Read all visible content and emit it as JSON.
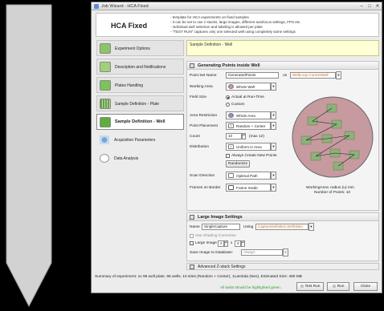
{
  "window": {
    "title": "Job Wizard - HCA Fixed",
    "minimize_glyph": "–",
    "maximize_glyph": "□",
    "close_glyph": "✕"
  },
  "header": {
    "title": "HCA Fixed",
    "description": [
      "template for HCA experiments on fixed samples",
      "it can be set to use z-stacks, large images, different autofocus settings, FPS etc.",
      "individual well selection and labeling is allowed per plate",
      "\"TEST RUN\" captures only one selected well using completely same settings"
    ]
  },
  "sidebar": {
    "items": [
      {
        "label": "Experiment Options",
        "icon": "experiment-options-icon"
      },
      {
        "label": "Description and Notifications",
        "icon": "description-icon"
      },
      {
        "label": "Plates Handling",
        "icon": "plates-handling-icon"
      },
      {
        "label": "Sample Definition - Plate",
        "icon": "plate-definition-icon"
      },
      {
        "label": "Sample Definition - Well",
        "icon": "well-definition-icon"
      },
      {
        "label": "Acquisition Parameters",
        "icon": "acquisition-icon"
      },
      {
        "label": "Data Analysis",
        "icon": "data-analysis-icon"
      }
    ]
  },
  "main": {
    "breadcrumb": "Sample Definition - Well",
    "points_section": {
      "title": "Generating Points inside Well",
      "point_set_name_label": "Point Set Name",
      "point_set_name_value": "GeneratedPoints",
      "on_label": "on",
      "on_value": "WellLoop.CurrentWell",
      "working_area_label": "Working Area",
      "working_area_value": "Whole Well",
      "field_size_label": "Field Size",
      "field_size_options": [
        "Actual at Run-Time",
        "Custom"
      ],
      "area_restriction_label": "Area Restriction",
      "area_restriction_value": "Whole Area",
      "point_placement_label": "Point Placement",
      "point_placement_value": "Random + Center",
      "count_label": "Count",
      "count_value": "10",
      "count_max": "(max 12)",
      "distribution_label": "Distribution",
      "distribution_value": "Uniform in Area",
      "always_create_label": "Always Create New Points",
      "randomize_label": "Randomize",
      "scan_direction_label": "Scan Direction",
      "scan_direction_value": "Optimal Path",
      "frames_on_border_label": "Frames on Border",
      "frames_on_border_value": "Frame Inside",
      "working_area_radius": "WorkingArea: radius (u) mm",
      "number_of_points": "Number of Points: 10"
    },
    "large_image_section": {
      "title": "Large Image Settings",
      "name_label": "Name",
      "name_value": "SingleCapture",
      "using_label": "Using",
      "using_value": "CaptureDefinition.Definition",
      "use_shading_label": "Use Shading Correction",
      "large_image_label": "Large Image",
      "large_image_x": "2",
      "large_image_times": "x",
      "large_image_y": "2",
      "save_label": "Save Image to Database:",
      "save_value": "Always"
    },
    "advanced_label": "Advanced Z-stack Settings"
  },
  "footer": {
    "summary": "Summary of experiment: 1x 96 well plate, 96 wells, 10 sites (Random + Center), 1Lambda (Nex), Estimated Size: 480 MB",
    "note": "All tasks should be highlighted green.",
    "test_run": "Test Run",
    "run": "Run",
    "close": "Close"
  },
  "colors": {
    "accent_green": "#2d9a2d",
    "well_fill": "#c79aa0",
    "tile_fill": "#8fb07a",
    "orange_text": "#c86a18"
  },
  "chart_data": {
    "type": "scatter",
    "title": "",
    "xlabel": "",
    "ylabel": "",
    "field_count": 10
  }
}
